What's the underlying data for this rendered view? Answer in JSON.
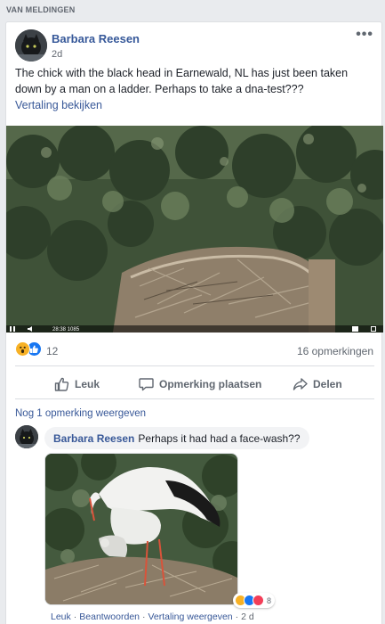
{
  "section_header": "VAN MELDINGEN",
  "post": {
    "author": "Barbara Reesen",
    "timestamp": "2d",
    "more_label": "•••",
    "text": "The chick with the black head in Earnewald, NL has just been taken down by a man on a ladder. Perhaps to take a dna-test???",
    "translate_link": "Vertaling bekijken",
    "video_time": "28:38 1085",
    "reactions": [
      "wow",
      "like"
    ],
    "reaction_count": "12",
    "comments_count": "16 opmerkingen"
  },
  "actions": {
    "like": "Leuk",
    "comment": "Opmerking plaatsen",
    "share": "Delen"
  },
  "comments": {
    "more_link": "Nog 1 opmerking weergeven",
    "item": {
      "author": "Barbara Reesen",
      "text": "Perhaps it had had a face-wash??",
      "reaction_icons": [
        "wow",
        "like",
        "love"
      ],
      "reaction_count": "8",
      "like_link": "Leuk",
      "reply_link": "Beantwoorden",
      "translate_link": "Vertaling weergeven",
      "timestamp": "2 d",
      "separator": "·"
    }
  },
  "colors": {
    "link": "#385898",
    "author": "#365899",
    "like_blue": "#1877f2",
    "wow_yellow": "#f7b125",
    "love_red": "#f33e58"
  }
}
